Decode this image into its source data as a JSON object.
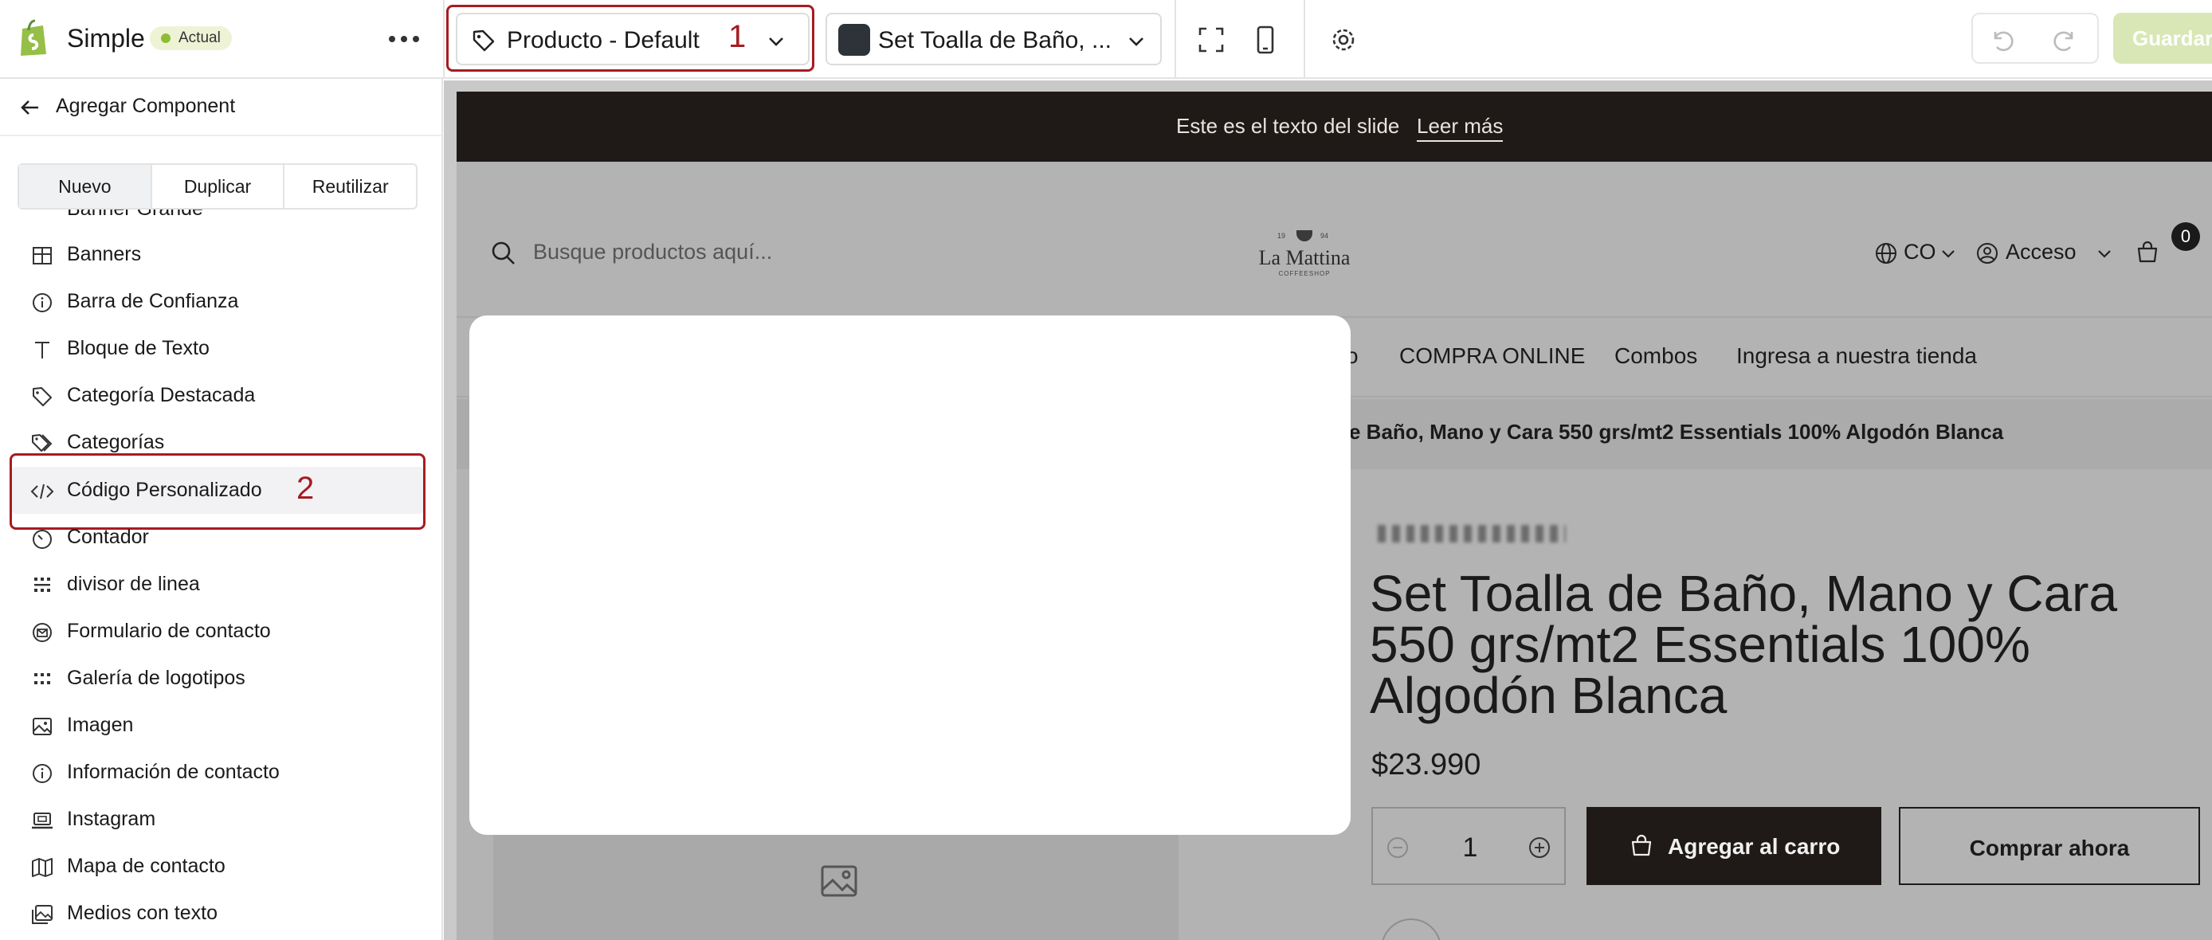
{
  "app": {
    "name": "Simple",
    "status_badge": "Actual"
  },
  "toolbar": {
    "template_select": {
      "label": "Producto - Default",
      "annotation": "1"
    },
    "product_select": {
      "label": "Set Toalla de Baño, ..."
    },
    "save_label": "Guardar"
  },
  "sidebar": {
    "back_title": "Agregar Component",
    "tabs": [
      {
        "label": "Nuevo",
        "active": true
      },
      {
        "label": "Duplicar",
        "active": false
      },
      {
        "label": "Reutilizar",
        "active": false
      }
    ],
    "partial_item": "Banner Grande",
    "items": [
      {
        "label": "Banners",
        "icon": "table-icon"
      },
      {
        "label": "Barra de Confianza",
        "icon": "info-icon"
      },
      {
        "label": "Bloque de Texto",
        "icon": "text-icon"
      },
      {
        "label": "Categoría Destacada",
        "icon": "tag-icon"
      },
      {
        "label": "Categorías",
        "icon": "tags-icon"
      },
      {
        "label": "Código Personalizado",
        "icon": "code-icon",
        "annotation": "2"
      },
      {
        "label": "Contador",
        "icon": "timer-icon"
      },
      {
        "label": "divisor de linea",
        "icon": "grid-icon"
      },
      {
        "label": "Formulario de contacto",
        "icon": "mail-icon"
      },
      {
        "label": "Galería de logotipos",
        "icon": "dots-grid-icon"
      },
      {
        "label": "Imagen",
        "icon": "image-icon"
      },
      {
        "label": "Información de contacto",
        "icon": "info-icon"
      },
      {
        "label": "Instagram",
        "icon": "laptop-icon"
      },
      {
        "label": "Mapa de contacto",
        "icon": "map-icon"
      },
      {
        "label": "Medios con texto",
        "icon": "images-icon"
      }
    ]
  },
  "store": {
    "announcement": {
      "text": "Este es el texto del slide",
      "link": "Leer más"
    },
    "search_placeholder": "Busque productos aquí...",
    "brand": {
      "name": "La Mattina",
      "sub": "COFFEESHOP",
      "year_left": "19",
      "year_right": "94"
    },
    "country": "CO",
    "account": "Acceso",
    "cart_count": "0",
    "nav": [
      "o",
      "COMPRA ONLINE",
      "Combos",
      "Ingresa a nuestra tienda"
    ],
    "breadcrumb": "e Baño, Mano y Cara 550 grs/mt2 Essentials 100% Algodón Blanca",
    "product": {
      "title": "Set Toalla de Baño, Mano y Cara 550 grs/mt2 Essentials 100% Algodón Blanca",
      "price": "$23.990",
      "quantity": "1",
      "add_to_cart": "Agregar al carro",
      "buy_now": "Comprar ahora"
    }
  },
  "colors": {
    "accent_annotation": "#a61c22",
    "announcement_bg": "#1f1a17",
    "badge_dot": "#8fbc32",
    "save_button": "#d9e7b6"
  }
}
